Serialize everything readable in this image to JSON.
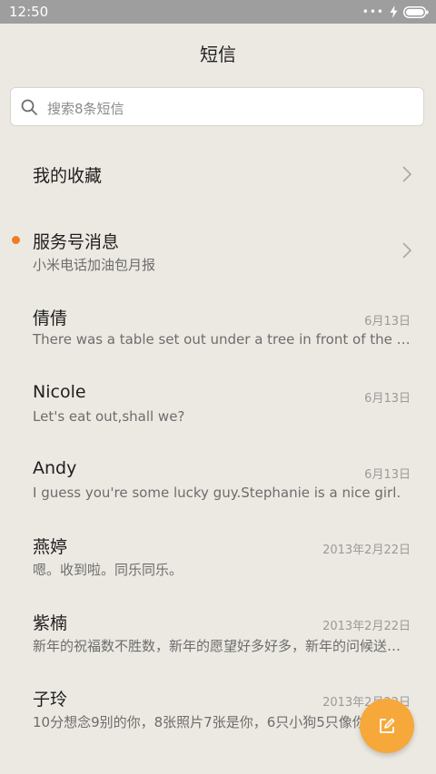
{
  "status_bar": {
    "time": "12:50",
    "icons": [
      "more-dots-icon",
      "charging-bolt-icon",
      "battery-icon"
    ]
  },
  "header": {
    "title": "短信"
  },
  "search": {
    "placeholder": "搜索8条短信",
    "icon": "search-icon"
  },
  "favorites": {
    "label": "我的收藏"
  },
  "service": {
    "label": "服务号消息",
    "subtitle": "小米电话加油包月报",
    "unread_color": "#f07c2a"
  },
  "conversations": [
    {
      "name": "倩倩",
      "date": "6月13日",
      "preview": "There was a table set out under a tree in front of the house"
    },
    {
      "name": "Nicole",
      "date": "6月13日",
      "preview": "Let's eat out,shall we?"
    },
    {
      "name": "Andy",
      "date": "6月13日",
      "preview": "I guess you're some lucky guy.Stephanie is a nice girl."
    },
    {
      "name": "燕婷",
      "date": "2013年2月22日",
      "preview": "嗯。收到啦。同乐同乐。"
    },
    {
      "name": "紫楠",
      "date": "2013年2月22日",
      "preview": "新年的祝福数不胜数，新年的愿望好多好多，新年的问候送给你"
    },
    {
      "name": "子玲",
      "date": "2013年2月22日",
      "preview": "10分想念9别的你，8张照片7张是你，6只小狗5只像你"
    }
  ],
  "fab": {
    "icon": "compose-icon",
    "color": "#f6a83a"
  }
}
